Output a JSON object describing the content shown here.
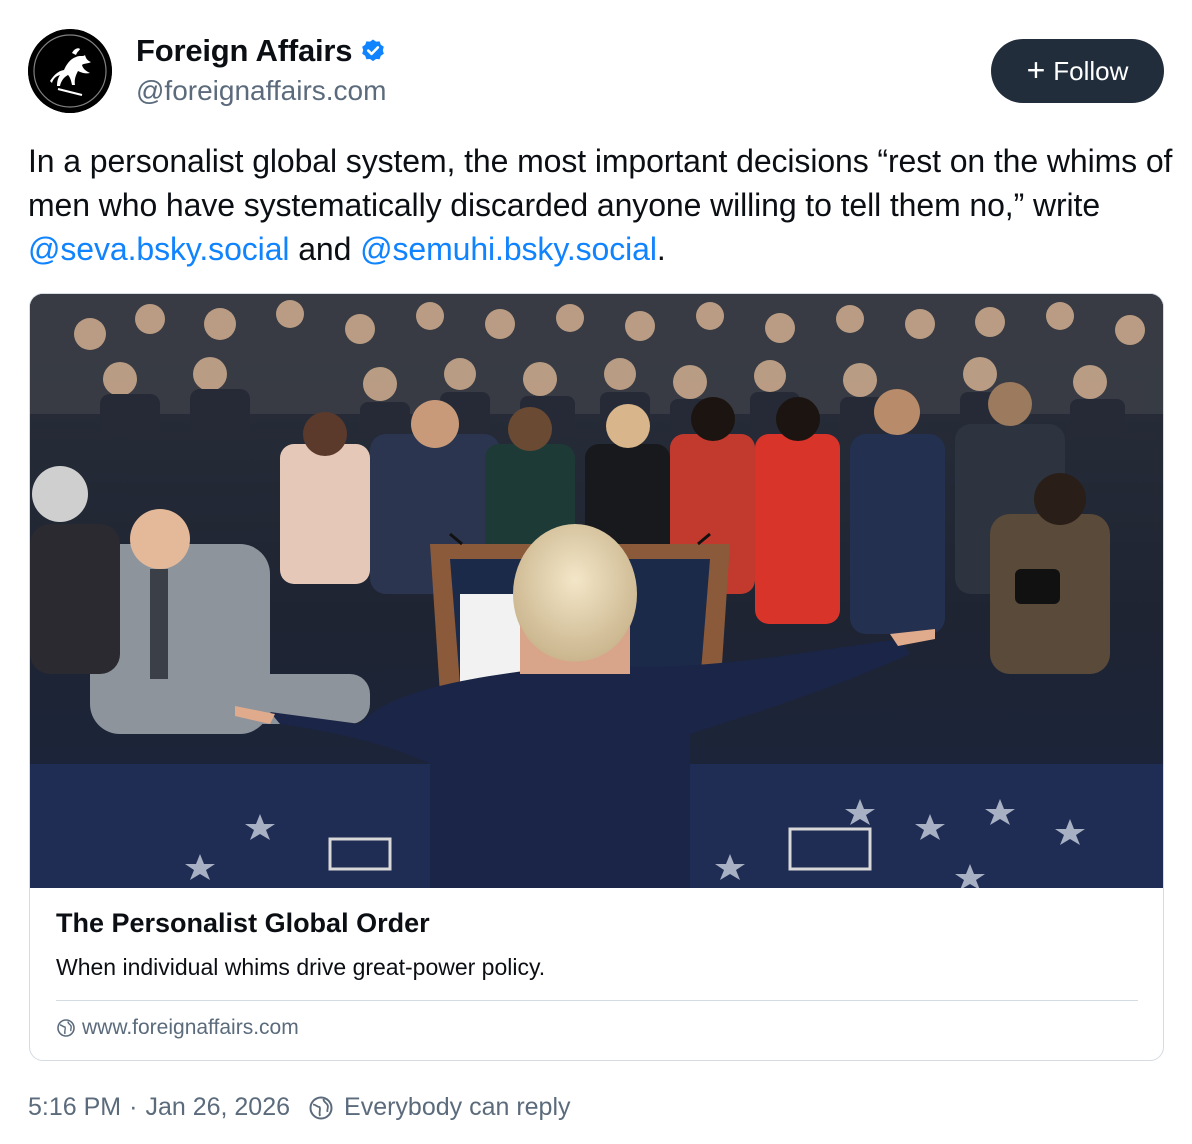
{
  "author": {
    "display_name": "Foreign Affairs",
    "handle": "@foreignaffairs.com",
    "avatar_icon": "knight-horse-logo",
    "verified_icon": "verified-badge-icon",
    "verified_color": "#1083fe"
  },
  "follow": {
    "icon": "plus-icon",
    "plus": "+",
    "label": "Follow"
  },
  "post": {
    "text_part1": "In a personalist global system, the most important decisions “rest on the whims of men who have systematically discarded anyone willing to tell them no,” write ",
    "mention1": "@seva.bsky.social",
    "text_part2": " and ",
    "mention2": "@semuhi.bsky.social",
    "text_part3": "."
  },
  "link_card": {
    "image_alt": "Speaker at a podium pointing at a room of seated reporters",
    "title": "The Personalist Global Order",
    "description": "When individual whims drive great-power policy.",
    "domain_icon": "globe-icon",
    "domain": "www.foreignaffairs.com"
  },
  "footer": {
    "time": "5:16 PM",
    "separator": "·",
    "date": "Jan 26, 2026",
    "reply_icon": "globe-icon",
    "reply_setting": "Everybody can reply"
  },
  "colors": {
    "link": "#1083fe",
    "muted": "#5b6b7c",
    "follow_bg": "#212d3b",
    "border": "#d4dbe2"
  }
}
